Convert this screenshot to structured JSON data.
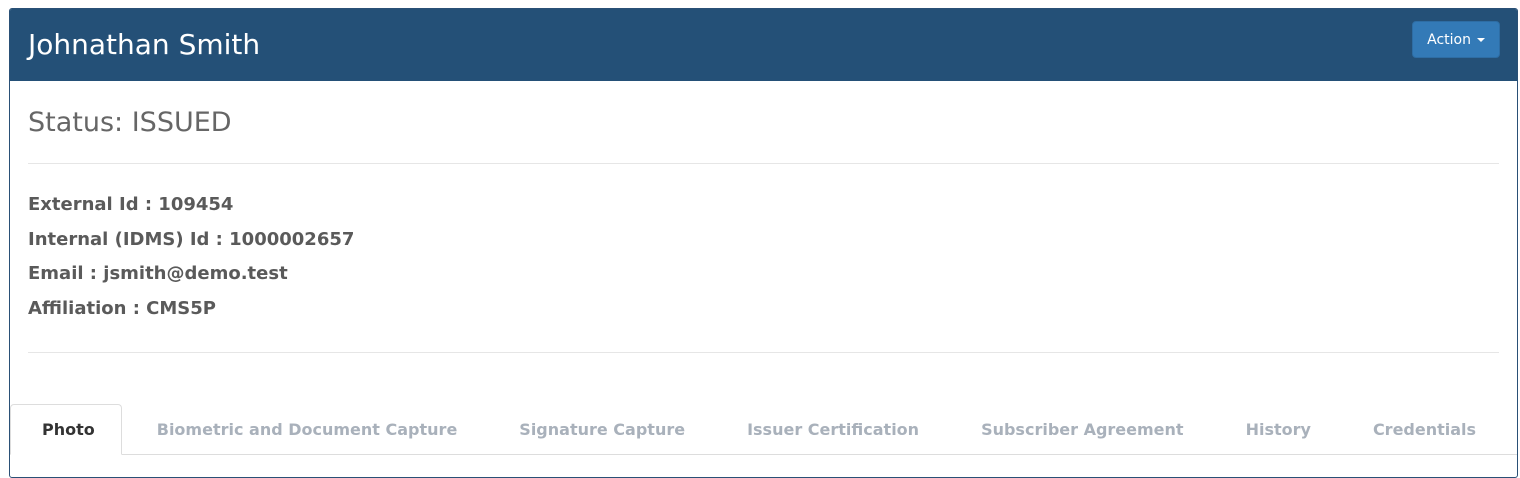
{
  "header": {
    "title": "Johnathan Smith",
    "action_label": "Action"
  },
  "status": {
    "label": "Status: ISSUED"
  },
  "details": {
    "external_id": "External Id : 109454",
    "internal_id": "Internal (IDMS) Id : 1000002657",
    "email": "Email : jsmith@demo.test",
    "affiliation": "Affiliation : CMS5P"
  },
  "tabs": [
    {
      "label": "Photo",
      "active": true
    },
    {
      "label": "Biometric and Document Capture",
      "active": false
    },
    {
      "label": "Signature Capture",
      "active": false
    },
    {
      "label": "Issuer Certification",
      "active": false
    },
    {
      "label": "Subscriber Agreement",
      "active": false
    },
    {
      "label": "History",
      "active": false
    },
    {
      "label": "Credentials",
      "active": false
    }
  ],
  "colors": {
    "header_bg": "#245077",
    "action_button": "#337ab7",
    "tab_inactive": "#a9b1bb"
  },
  "icons": {
    "action_caret": "caret-down-icon"
  }
}
